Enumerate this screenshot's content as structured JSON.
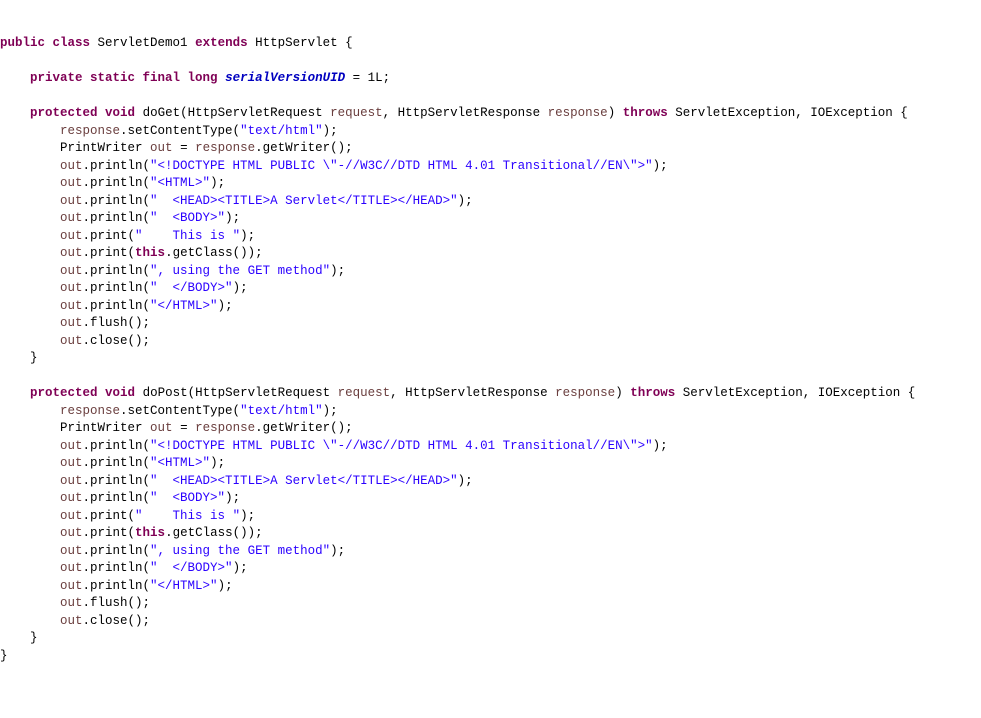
{
  "c": {
    "l1": "public class",
    "l1b": "ServletDemo1",
    "l1c": "extends",
    "l1d": "HttpServlet {",
    "l3a": "private static final long",
    "l3b": "serialVersionUID",
    "l3c": " = 1L;",
    "m1a": "protected void",
    "m1b": "doGet(HttpServletRequest",
    "m1c": "request",
    "m1d": ", HttpServletResponse",
    "m1e": "response",
    "m1f": ")",
    "m1g": "throws",
    "m1h": "ServletException, IOException {",
    "g1a": "response",
    "g1b": ".setContentType(",
    "g1c": "\"text/html\"",
    "g1d": ");",
    "g2a": "PrintWriter",
    "g2b": "out",
    "g2c": " = ",
    "g2d": "response",
    "g2e": ".getWriter();",
    "g3a": "out",
    "g3b": ".println(",
    "g3c": "\"<!DOCTYPE HTML PUBLIC \\\"-//W3C//DTD HTML 4.01 Transitional//EN\\\">\"",
    "g3d": ");",
    "g4c": "\"<HTML>\"",
    "g5c": "\"  <HEAD><TITLE>A Servlet</TITLE></HEAD>\"",
    "g6c": "\"  <BODY>\"",
    "g7b": ".print(",
    "g7c": "\"    This is \"",
    "g8a": "out",
    "g8b": ".print(",
    "g8c": "this",
    "g8d": ".getClass());",
    "g9c": "\", using the GET method\"",
    "g10c": "\"  </BODY>\"",
    "g11c": "\"</HTML>\"",
    "g12": ".flush();",
    "g13": ".close();",
    "rb": "}",
    "m2a": "protected void",
    "m2b": "doPost(HttpServletRequest",
    "m2c": "request",
    "m2d": ", HttpServletResponse",
    "m2e": "response",
    "m2f": ")",
    "m2g": "throws",
    "m2h": "ServletException, IOException {"
  }
}
